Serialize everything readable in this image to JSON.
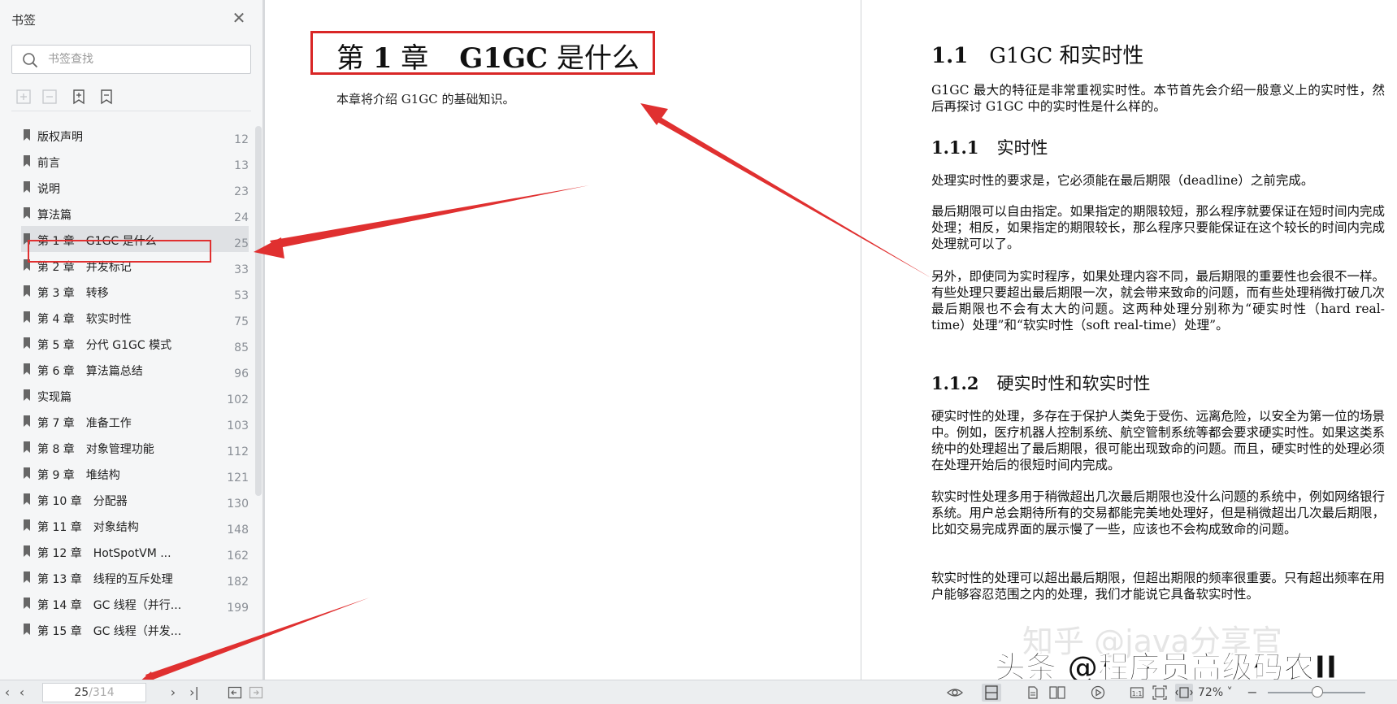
{
  "sidebar": {
    "title": "书签",
    "search_placeholder": "书签查找",
    "bookmarks": [
      {
        "label": "版权声明",
        "page": "12"
      },
      {
        "label": "前言",
        "page": "13"
      },
      {
        "label": "说明",
        "page": "23"
      },
      {
        "label": "算法篇",
        "page": "24"
      },
      {
        "label": "第 1 章　G1GC 是什么",
        "page": "25"
      },
      {
        "label": "第 2 章　并发标记",
        "page": "33"
      },
      {
        "label": "第 3 章　转移",
        "page": "53"
      },
      {
        "label": "第 4 章　软实时性",
        "page": "75"
      },
      {
        "label": "第 5 章　分代 G1GC 模式",
        "page": "85"
      },
      {
        "label": "第 6 章　算法篇总结",
        "page": "96"
      },
      {
        "label": "实现篇",
        "page": "102"
      },
      {
        "label": "第 7 章　准备工作",
        "page": "103"
      },
      {
        "label": "第 8 章　对象管理功能",
        "page": "112"
      },
      {
        "label": "第 9 章　堆结构",
        "page": "121"
      },
      {
        "label": "第 10 章　分配器",
        "page": "130"
      },
      {
        "label": "第 11 章　对象结构",
        "page": "148"
      },
      {
        "label": "第 12 章　HotSpotVM ...",
        "page": "162"
      },
      {
        "label": "第 13 章　线程的互斥处理",
        "page": "182"
      },
      {
        "label": "第 14 章　GC 线程（并行...",
        "page": "199"
      },
      {
        "label": "第 15 章　GC 线程（并发...",
        "page": ""
      }
    ],
    "selected_index": 4
  },
  "left_page": {
    "chapter_prefix": "第",
    "chapter_num": "1",
    "chapter_suffix": "章",
    "chapter_name_bold": "G1GC",
    "chapter_name_rest": "是什么",
    "intro": "本章将介绍 G1GC 的基础知识。"
  },
  "right_page": {
    "h1_num": "1.1",
    "h1_text": "G1GC 和实时性",
    "p1": "G1GC 最大的特征是非常重视实时性。本节首先会介绍一般意义上的实时性，然后再探讨 G1GC 中的实时性是什么样的。",
    "h2a_num": "1.1.1",
    "h2a_text": "实时性",
    "p2": "处理实时性的要求是，它必须能在最后期限（deadline）之前完成。",
    "p3": "最后期限可以自由指定。如果指定的期限较短，那么程序就要保证在短时间内完成处理；相反，如果指定的期限较长，那么程序只要能保证在这个较长的时间内完成处理就可以了。",
    "p4": "另外，即使同为实时程序，如果处理内容不同，最后期限的重要性也会很不一样。有些处理只要超出最后期限一次，就会带来致命的问题，而有些处理稍微打破几次最后期限也不会有太大的问题。这两种处理分别称为“硬实时性（hard real-time）处理”和“软实时性（soft real-time）处理”。",
    "h2b_num": "1.1.2",
    "h2b_text": "硬实时性和软实时性",
    "p5": "硬实时性的处理，多存在于保护人类免于受伤、远离危险，以安全为第一位的场景中。例如，医疗机器人控制系统、航空管制系统等都会要求硬实时性。如果这类系统中的处理超出了最后期限，很可能出现致命的问题。而且，硬实时性的处理必须在处理开始后的很短时间内完成。",
    "p6": "软实时性处理多用于稍微超出几次最后期限也没什么问题的系统中，例如网络银行系统。用户总会期待所有的交易都能完美地处理好，但是稍微超出几次最后期限，比如交易完成界面的展示慢了一些，应该也不会构成致命的问题。",
    "p7": "软实时性的处理可以超出最后期限，但超出期限的频率很重要。只有超出频率在用户能够容忍范围之内的处理，我们才能说它具备软实时性。"
  },
  "watermark": {
    "zhihu": "知乎 @java分享官",
    "toutiao": "头条 @程序员高级码农II"
  },
  "statusbar": {
    "current_page": "25",
    "total_pages": "/314",
    "zoom": "72%"
  },
  "colors": {
    "annotation_red": "#e03030",
    "sidebar_bg": "#f5f6f7",
    "selected_bg": "#dfe1e4"
  }
}
